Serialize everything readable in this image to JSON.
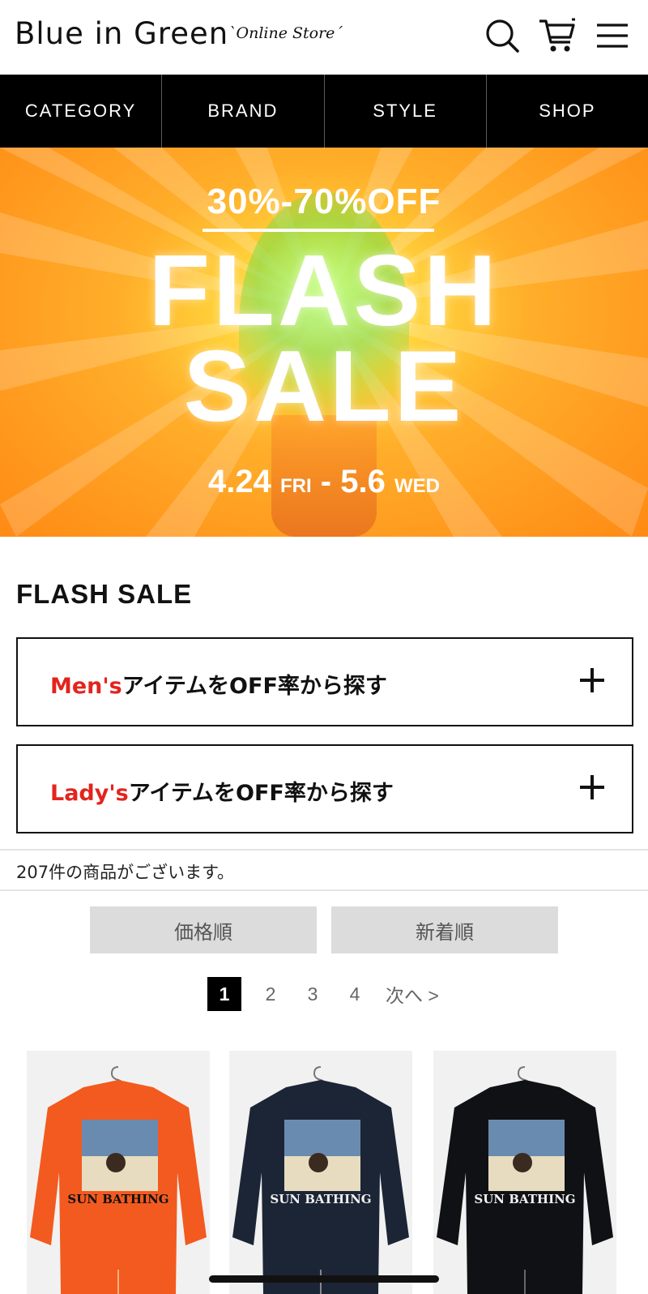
{
  "header": {
    "logo": "Blue in Green",
    "logo_sub": "`Online Store´",
    "icons": [
      "search-icon",
      "cart-icon",
      "menu-icon"
    ]
  },
  "nav": {
    "items": [
      {
        "label": "CATEGORY"
      },
      {
        "label": "BRAND"
      },
      {
        "label": "STYLE"
      },
      {
        "label": "SHOP"
      }
    ]
  },
  "banner": {
    "discount": "30%-70%OFF",
    "title_line1": "FLASH",
    "title_line2": "SALE",
    "date_start": "4.24",
    "date_start_day": "FRI",
    "date_sep": "-",
    "date_end": "5.6",
    "date_end_day": "WED",
    "colors": {
      "bg": "#ff9a1f",
      "text": "#ffffff"
    }
  },
  "section": {
    "title": "FLASH SALE",
    "accordions": [
      {
        "highlight": "Men's",
        "text": "アイテムをOFF率から探す"
      },
      {
        "highlight": "Lady's",
        "text": "アイテムをOFF率から探す"
      }
    ],
    "highlight_color": "#e3241d"
  },
  "results": {
    "count_text": "207件の商品がございます。"
  },
  "sort": {
    "price_label": "価格順",
    "new_label": "新着順"
  },
  "pagination": {
    "pages": [
      "1",
      "2",
      "3",
      "4"
    ],
    "current": "1",
    "next_label": "次へ >"
  },
  "products": [
    {
      "color": "#f25a1f",
      "print_text": "SUN BATHING"
    },
    {
      "color": "#1c2536",
      "print_text": "SUN BATHING"
    },
    {
      "color": "#101114",
      "print_text": "SUN BATHING"
    }
  ]
}
